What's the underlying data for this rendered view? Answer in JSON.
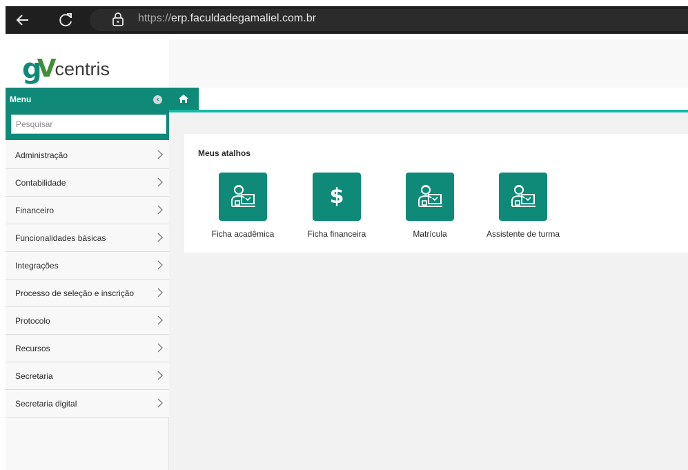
{
  "browser": {
    "url_scheme": "https://",
    "url_host": "erp.faculdadegamaliel.com.br",
    "icons": [
      "back-arrow-icon",
      "reload-icon",
      "lock-icon"
    ]
  },
  "brand": {
    "logo_g": "g",
    "logo_v": "V",
    "logo_text": "centris",
    "accent_color": "#0f8a78",
    "tab_line_color": "#15b8a3"
  },
  "sidebar": {
    "title": "Menu",
    "search_placeholder": "Pesquisar",
    "items": [
      {
        "label": "Administração"
      },
      {
        "label": "Contabilidade"
      },
      {
        "label": "Financeiro"
      },
      {
        "label": "Funcionalidades básicas"
      },
      {
        "label": "Integrações"
      },
      {
        "label": "Processo de seleção e inscrição"
      },
      {
        "label": "Protocolo"
      },
      {
        "label": "Recursos"
      },
      {
        "label": "Secretaria"
      },
      {
        "label": "Secretaria digital"
      }
    ]
  },
  "main": {
    "home_tab_icon": "home-icon",
    "shortcuts_title": "Meus atalhos",
    "shortcuts": [
      {
        "label": "Ficha acadêmica",
        "icon": "student-computer-icon"
      },
      {
        "label": "Ficha financeira",
        "icon": "dollar-icon",
        "glyph": "$"
      },
      {
        "label": "Matrícula",
        "icon": "student-computer-icon"
      },
      {
        "label": "Assistente de turma",
        "icon": "student-computer-icon"
      }
    ]
  }
}
